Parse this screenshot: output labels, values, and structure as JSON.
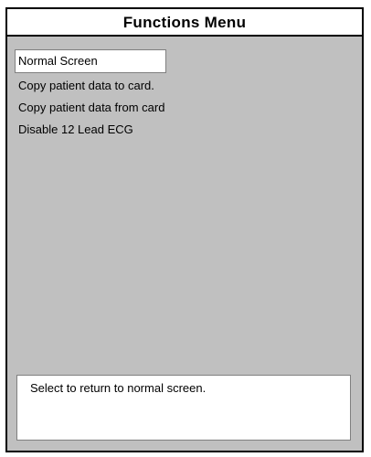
{
  "title": "Functions Menu",
  "menu": {
    "items": [
      {
        "label": "Normal Screen",
        "selected": true
      },
      {
        "label": "Copy patient data to card.",
        "selected": false
      },
      {
        "label": "Copy patient data from card",
        "selected": false
      },
      {
        "label": "Disable 12 Lead ECG",
        "selected": false
      }
    ]
  },
  "help_text": "Select to return to normal screen.",
  "colors": {
    "background": "#c0c0c0",
    "panel": "#ffffff",
    "border": "#000000"
  }
}
